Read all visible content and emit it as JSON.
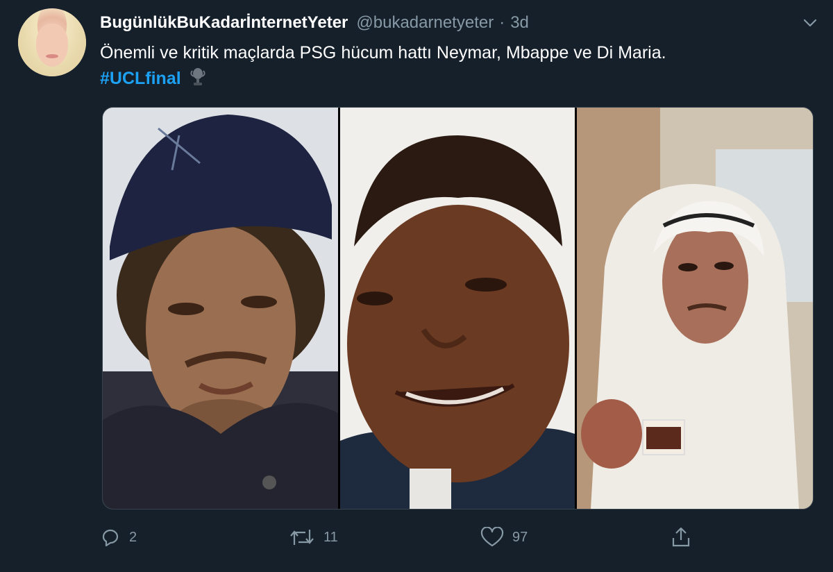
{
  "tweet": {
    "display_name": "BugünlükBuKadarİnternetYeter",
    "handle": "@bukadarnetyeter",
    "separator": "·",
    "timestamp": "3d",
    "text": "Önemli ve kritik maçlarda PSG hücum hattı Neymar, Mbappe ve Di Maria.",
    "hashtag": "#UCLfinal",
    "emoji_icon": "trophy-icon",
    "media": [
      {
        "icon": "photo-person-cap"
      },
      {
        "icon": "photo-person-smiling"
      },
      {
        "icon": "photo-person-headscarf-tea"
      }
    ],
    "actions": {
      "reply_count": "2",
      "retweet_count": "11",
      "like_count": "97"
    }
  },
  "colors": {
    "background": "#15202b",
    "text": "#ffffff",
    "muted": "#8899a6",
    "link": "#1da1f2",
    "border": "#38444d"
  }
}
